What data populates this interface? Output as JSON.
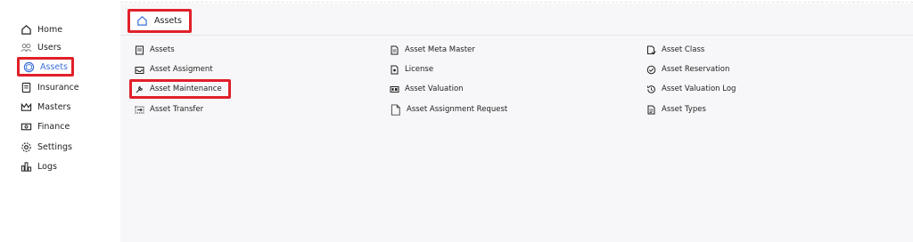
{
  "sidebar": {
    "items": [
      {
        "label": "Home",
        "icon": "home-icon"
      },
      {
        "label": "Users",
        "icon": "users-icon"
      },
      {
        "label": "Assets",
        "icon": "assets-icon"
      },
      {
        "label": "Insurance",
        "icon": "insurance-icon"
      },
      {
        "label": "Masters",
        "icon": "masters-icon"
      },
      {
        "label": "Finance",
        "icon": "finance-icon"
      },
      {
        "label": "Settings",
        "icon": "settings-icon"
      },
      {
        "label": "Logs",
        "icon": "logs-icon"
      }
    ]
  },
  "tab": {
    "label": "Assets",
    "icon": "home-icon"
  },
  "links": {
    "col1": [
      "Assets",
      "Asset Assigment",
      "Asset Maintenance",
      "Asset Transfer"
    ],
    "col2": [
      "Asset Meta Master",
      "License",
      "Asset Valuation",
      "Asset Assignment Request"
    ],
    "col3": [
      "Asset Class",
      "Asset Reservation",
      "Asset Valuation Log",
      "Asset Types"
    ]
  },
  "colors": {
    "highlight": "#e0202a",
    "accent": "#3b6fd8"
  }
}
